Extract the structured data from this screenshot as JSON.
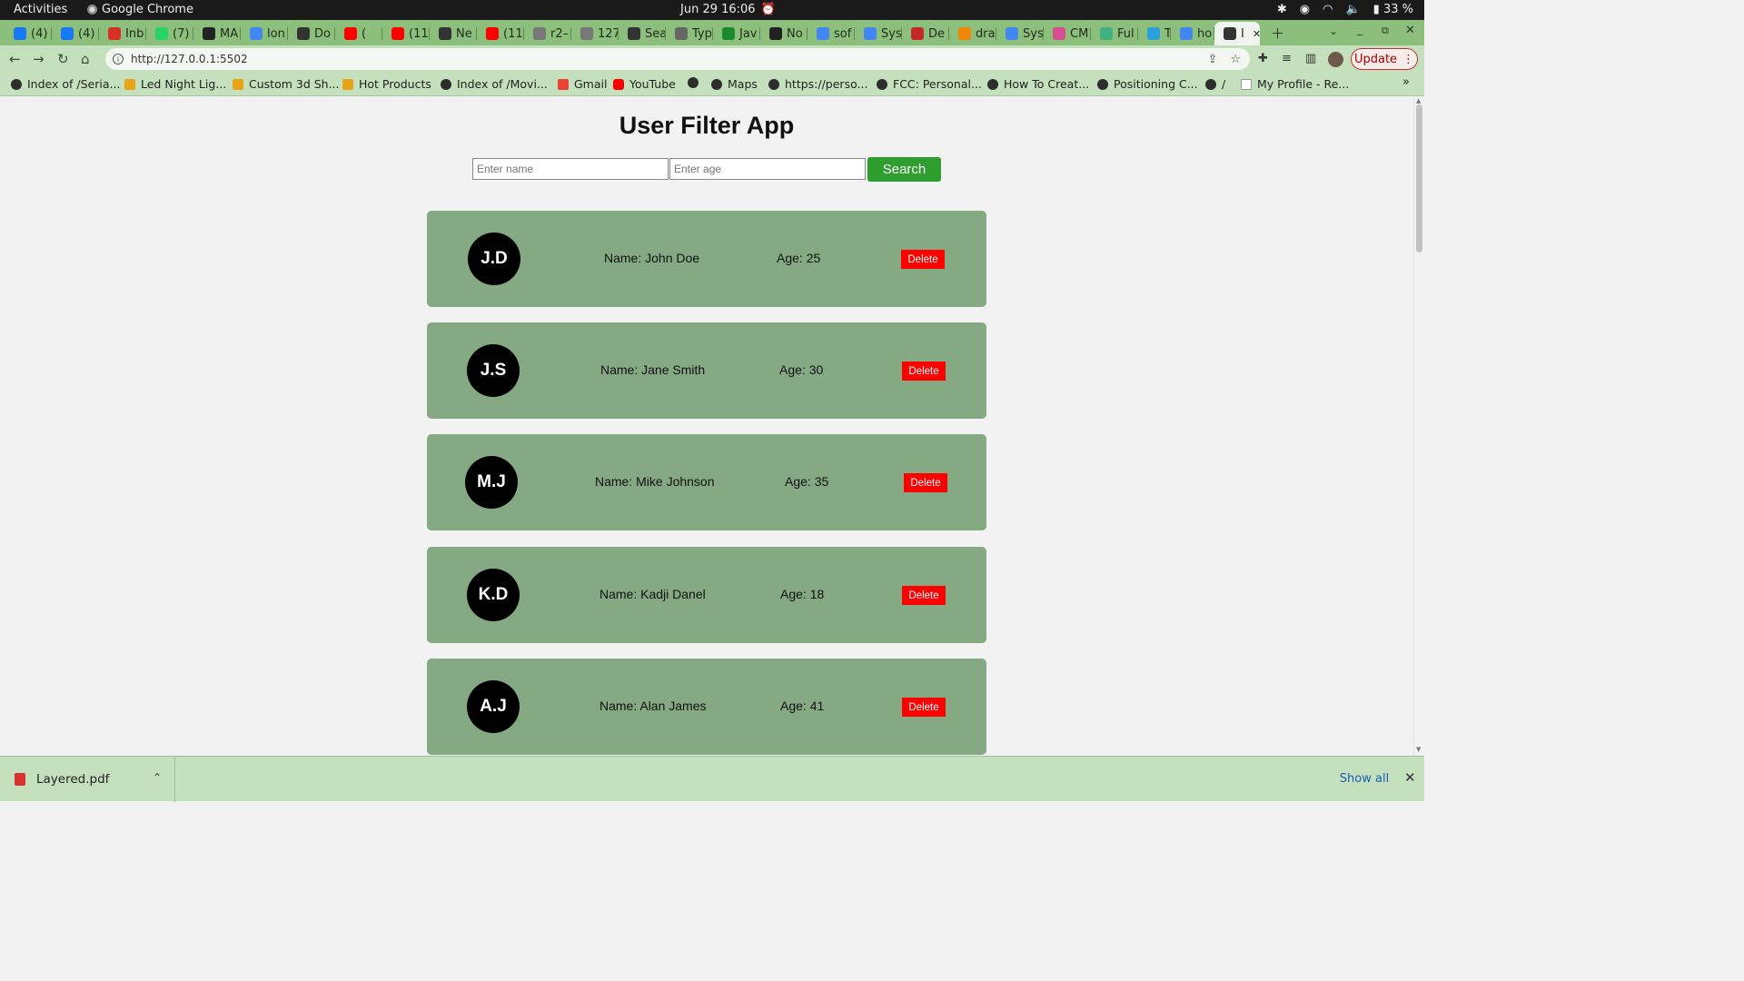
{
  "system": {
    "activities": "Activities",
    "app_name": "Google Chrome",
    "datetime": "Jun 29  16:06",
    "battery": "33 %"
  },
  "tabs": [
    {
      "label": "(4)",
      "favicon": "facebook-icon",
      "color": "#1877f2"
    },
    {
      "label": "(4)",
      "favicon": "facebook-icon",
      "color": "#1877f2"
    },
    {
      "label": "Inb",
      "favicon": "gmail-icon",
      "color": "#d93025"
    },
    {
      "label": "(7)",
      "favicon": "whatsapp-icon",
      "color": "#25d366"
    },
    {
      "label": "MA",
      "favicon": "github-icon",
      "color": "#222222"
    },
    {
      "label": "lon",
      "favicon": "google-icon",
      "color": "#4285f4"
    },
    {
      "label": "Do",
      "favicon": "globe-icon",
      "color": "#333333"
    },
    {
      "label": "(",
      "favicon": "youtube-icon",
      "color": "#ff0000"
    },
    {
      "label": "(11",
      "favicon": "youtube-icon",
      "color": "#ff0000"
    },
    {
      "label": "Ne",
      "favicon": "globe-icon",
      "color": "#333333"
    },
    {
      "label": "(11",
      "favicon": "youtube-icon",
      "color": "#ff0000"
    },
    {
      "label": "r2–",
      "favicon": "globe-icon",
      "color": "#777777"
    },
    {
      "label": "127",
      "favicon": "globe-icon",
      "color": "#777777"
    },
    {
      "label": "Sea",
      "favicon": "globe-icon",
      "color": "#333333"
    },
    {
      "label": "Typ",
      "favicon": "globe-icon",
      "color": "#666666"
    },
    {
      "label": "Jav",
      "favicon": "w-icon",
      "color": "#1a8a2e"
    },
    {
      "label": "No",
      "favicon": "github-icon",
      "color": "#222222"
    },
    {
      "label": "sof",
      "favicon": "google-icon",
      "color": "#4285f4"
    },
    {
      "label": "Sys",
      "favicon": "google-icon",
      "color": "#4285f4"
    },
    {
      "label": "De",
      "favicon": "pdf-icon",
      "color": "#c62828"
    },
    {
      "label": "dra",
      "favicon": "drawio-icon",
      "color": "#f08705"
    },
    {
      "label": "Sys",
      "favicon": "google-icon",
      "color": "#4285f4"
    },
    {
      "label": "CM",
      "favicon": "globe-icon",
      "color": "#d84f8f"
    },
    {
      "label": "Ful",
      "favicon": "globe-icon",
      "color": "#3fb27f"
    },
    {
      "label": "Tel",
      "favicon": "telegram-icon",
      "color": "#2aa1da"
    },
    {
      "label": "ho",
      "favicon": "google-icon",
      "color": "#4285f4"
    },
    {
      "label": "I",
      "favicon": "globe-icon",
      "color": "#333333",
      "active": true
    }
  ],
  "toolbar": {
    "url": "http://127.0.0.1:5502",
    "update_label": "Update"
  },
  "bookmarks": [
    {
      "label": "Index of /Seria...",
      "icon": "globe-icon"
    },
    {
      "label": "Led Night Lig...",
      "icon": "aliexpress-icon"
    },
    {
      "label": "Custom 3d Sh...",
      "icon": "aliexpress-icon"
    },
    {
      "label": "Hot Products",
      "icon": "aliexpress-icon"
    },
    {
      "label": "Index of /Movi...",
      "icon": "folder-icon"
    },
    {
      "label": "Gmail",
      "icon": "gmail-icon"
    },
    {
      "label": "YouTube",
      "icon": "youtube-icon"
    },
    {
      "label": "",
      "icon": "globe-icon"
    },
    {
      "label": "Maps",
      "icon": "maps-icon"
    },
    {
      "label": "https://perso...",
      "icon": "globe-icon"
    },
    {
      "label": "FCC: Personal...",
      "icon": "fcc-icon"
    },
    {
      "label": "How To Creat...",
      "icon": "w-icon"
    },
    {
      "label": "Positioning C...",
      "icon": "code-icon"
    },
    {
      "label": "/",
      "icon": "globe-icon"
    },
    {
      "label": "My Profile - Re...",
      "icon": "doc-icon"
    }
  ],
  "app": {
    "title": "User Filter App",
    "name_placeholder": "Enter name",
    "age_placeholder": "Enter age",
    "search_label": "Search",
    "delete_label": "Delete",
    "users": [
      {
        "initials": "J.D",
        "name": "Name: John Doe",
        "age": "Age: 25"
      },
      {
        "initials": "J.S",
        "name": "Name: Jane Smith",
        "age": "Age: 30"
      },
      {
        "initials": "M.J",
        "name": "Name: Mike Johnson",
        "age": "Age: 35"
      },
      {
        "initials": "K.D",
        "name": "Name: Kadji Danel",
        "age": "Age: 18"
      },
      {
        "initials": "A.J",
        "name": "Name: Alan James",
        "age": "Age: 41"
      }
    ]
  },
  "downloads": {
    "file": "Layered.pdf",
    "show_all": "Show all"
  },
  "colors": {
    "card_bg": "#84a983",
    "search_bg": "#2e9e2e",
    "delete_bg": "#ff0000",
    "tabstrip_bg": "#8dbf7c"
  }
}
